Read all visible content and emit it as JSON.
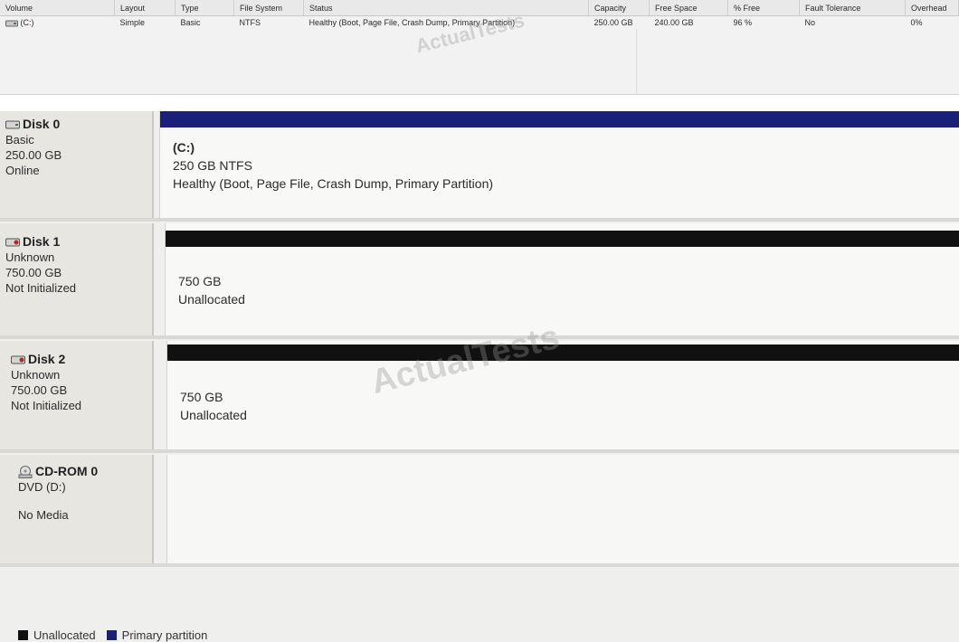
{
  "volume_list": {
    "columns": [
      "Volume",
      "Layout",
      "Type",
      "File System",
      "Status",
      "Capacity",
      "Free Space",
      "% Free",
      "Fault Tolerance",
      "Overhead"
    ],
    "rows": [
      {
        "volume": "(C:)",
        "layout": "Simple",
        "type": "Basic",
        "file_system": "NTFS",
        "status": "Healthy (Boot, Page File, Crash Dump, Primary Partition)",
        "capacity": "250.00 GB",
        "free_space": "240.00 GB",
        "percent_free": "96 %",
        "fault_tolerance": "No",
        "overhead": "0%"
      }
    ]
  },
  "disks": [
    {
      "name": "Disk 0",
      "type": "Basic",
      "size": "250.00 GB",
      "state": "Online",
      "partition": {
        "title": "(C:)",
        "line1": "250 GB NTFS",
        "line2": "Healthy (Boot, Page File, Crash Dump, Primary Partition)",
        "kind": "primary"
      }
    },
    {
      "name": "Disk 1",
      "type": "Unknown",
      "size": "750.00 GB",
      "state": "Not Initialized",
      "partition": {
        "title": "",
        "line1": "750 GB",
        "line2": "Unallocated",
        "kind": "unallocated"
      }
    },
    {
      "name": "Disk 2",
      "type": "Unknown",
      "size": "750.00 GB",
      "state": "Not Initialized",
      "partition": {
        "title": "",
        "line1": "750 GB",
        "line2": "Unallocated",
        "kind": "unallocated"
      }
    },
    {
      "name": "CD-ROM 0",
      "type": "DVD (D:)",
      "size": "",
      "state": "No Media"
    }
  ],
  "legend": {
    "unallocated": "Unallocated",
    "primary": "Primary partition"
  },
  "colors": {
    "primary": "#1a1f7a",
    "unallocated": "#111111"
  },
  "watermark": "ActualTests"
}
